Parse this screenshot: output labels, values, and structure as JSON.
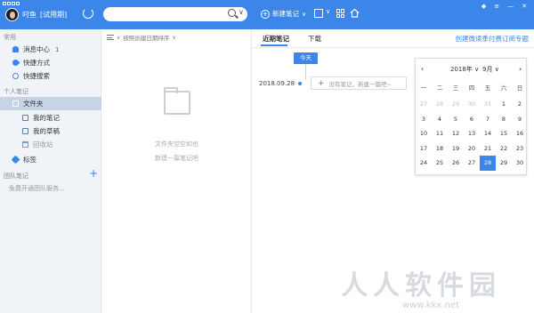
{
  "header": {
    "username": "叼鱼",
    "trial": "[试用期]",
    "search_placeholder": "",
    "new_note_label": "新建笔记",
    "icons": [
      "sync-icon",
      "search-icon",
      "plus-circle-icon",
      "crop-icon",
      "grid-icon",
      "home-icon"
    ]
  },
  "sidebar": {
    "common_label": "常用",
    "common_items": [
      {
        "label": "消息中心",
        "badge": "1",
        "icon": "bell-icon"
      },
      {
        "label": "快捷方式",
        "icon": "rocket-icon"
      },
      {
        "label": "快捷搜索",
        "icon": "search-icon"
      }
    ],
    "personal_label": "个人笔记",
    "folders_label": "文件夹",
    "folder_items": [
      {
        "label": "我的笔记",
        "icon": "folder-icon"
      },
      {
        "label": "我的草稿",
        "icon": "folder-icon"
      },
      {
        "label": "回收站",
        "icon": "trash-icon"
      }
    ],
    "tags_label": "标签",
    "team_label": "团队笔记",
    "team_hint": "免费开通团队服务...",
    "add_symbol": "+"
  },
  "list": {
    "sort_label": "按照创建日期排序",
    "empty_line1": "文件夹空空如也",
    "empty_line2": "新建一篇笔记吧"
  },
  "main": {
    "tabs": [
      {
        "label": "近期笔记",
        "active": true
      },
      {
        "label": "下载",
        "active": false
      }
    ],
    "promo": "创建微读季付费订阅专题",
    "timeline": {
      "today_label": "今天",
      "date": "2018.09.28",
      "input_placeholder": "没有笔记，新建一篇吧~",
      "plus": "+"
    }
  },
  "calendar": {
    "year": "2018年",
    "month": "9月",
    "prev": "‹",
    "next": "›",
    "weekdays": [
      "一",
      "二",
      "三",
      "四",
      "五",
      "六",
      "日"
    ],
    "weeks": [
      [
        {
          "d": "27",
          "out": true
        },
        {
          "d": "28",
          "out": true
        },
        {
          "d": "29",
          "out": true
        },
        {
          "d": "30",
          "out": true
        },
        {
          "d": "31",
          "out": true
        },
        {
          "d": "1"
        },
        {
          "d": "2"
        }
      ],
      [
        {
          "d": "3"
        },
        {
          "d": "4"
        },
        {
          "d": "5"
        },
        {
          "d": "6"
        },
        {
          "d": "7"
        },
        {
          "d": "8"
        },
        {
          "d": "9"
        }
      ],
      [
        {
          "d": "10"
        },
        {
          "d": "11"
        },
        {
          "d": "12"
        },
        {
          "d": "13"
        },
        {
          "d": "14"
        },
        {
          "d": "15"
        },
        {
          "d": "16"
        }
      ],
      [
        {
          "d": "17"
        },
        {
          "d": "18"
        },
        {
          "d": "19"
        },
        {
          "d": "20"
        },
        {
          "d": "21"
        },
        {
          "d": "22"
        },
        {
          "d": "23"
        }
      ],
      [
        {
          "d": "24"
        },
        {
          "d": "25"
        },
        {
          "d": "26"
        },
        {
          "d": "27"
        },
        {
          "d": "28",
          "today": true
        },
        {
          "d": "29"
        },
        {
          "d": "30"
        }
      ]
    ]
  },
  "watermark": {
    "text": "人人软件园",
    "url": "www.kkx.net"
  },
  "colors": {
    "accent": "#3b86e8",
    "sidebar_bg": "#f0f4f9",
    "sidebar_active": "#c6d4e6"
  }
}
